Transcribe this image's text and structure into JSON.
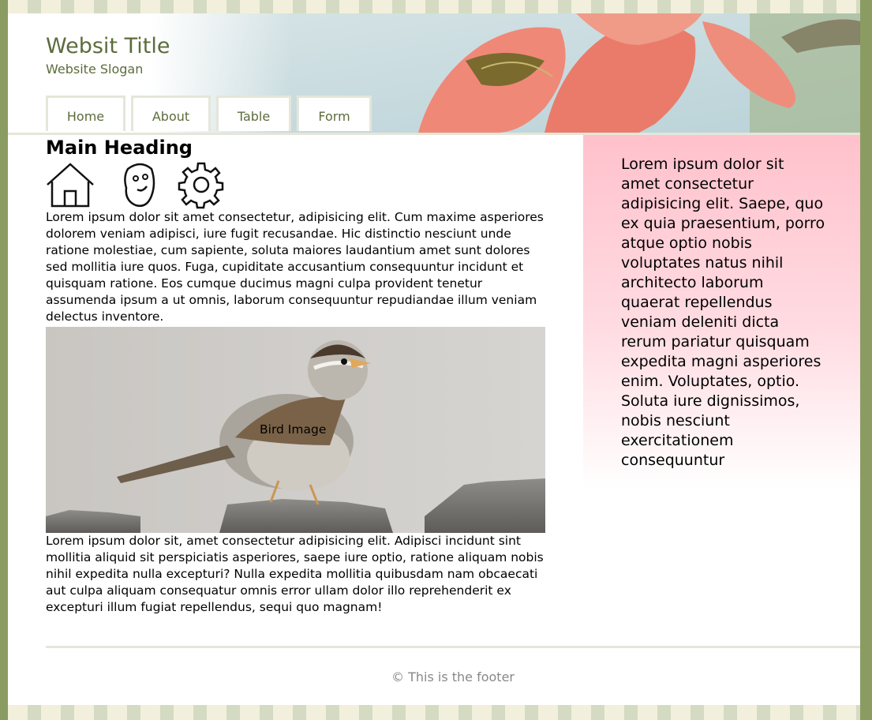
{
  "header": {
    "title": "Websit Title",
    "slogan": "Website Slogan"
  },
  "nav": {
    "items": [
      {
        "label": "Home"
      },
      {
        "label": "About"
      },
      {
        "label": "Table"
      },
      {
        "label": "Form"
      }
    ]
  },
  "main": {
    "heading": "Main Heading",
    "icons": [
      "home-icon",
      "face-icon",
      "gear-icon"
    ],
    "paragraph1": "Lorem ipsum dolor sit amet consectetur, adipisicing elit. Cum maxime asperiores dolorem veniam adipisci, iure fugit recusandae. Hic distinctio nesciunt unde ratione molestiae, cum sapiente, soluta maiores laudantium amet sunt dolores sed mollitia iure quos. Fuga, cupiditate accusantium consequuntur incidunt et quisquam ratione. Eos cumque ducimus magni culpa provident tenetur assumenda ipsum a ut omnis, laborum consequuntur repudiandae illum veniam delectus inventore.",
    "image_caption": "Bird Image",
    "paragraph2": "Lorem ipsum dolor sit, amet consectetur adipisicing elit. Adipisci incidunt sint mollitia aliquid sit perspiciatis asperiores, saepe iure optio, ratione aliquam nobis nihil expedita nulla excepturi? Nulla expedita mollitia quibusdam nam obcaecati aut culpa aliquam consequatur omnis error ullam dolor illo reprehenderit ex excepturi illum fugiat repellendus, sequi quo magnam!"
  },
  "sidebar": {
    "text": "Lorem ipsum dolor sit amet consectetur adipisicing elit. Saepe, quo ex quia praesentium, porro atque optio nobis voluptates natus nihil architecto laborum quaerat repellendus veniam deleniti dicta rerum pariatur quisquam expedita magni asperiores enim. Voluptates, optio. Soluta iure dignissimos, nobis nesciunt exercitationem consequuntur"
  },
  "footer": {
    "text": "© This is the footer"
  },
  "colors": {
    "border_green": "#8a9c62",
    "title_green": "#5c6c3c",
    "sidebar_pink": "#ffc1cc",
    "nav_border": "#e5e6d9"
  }
}
